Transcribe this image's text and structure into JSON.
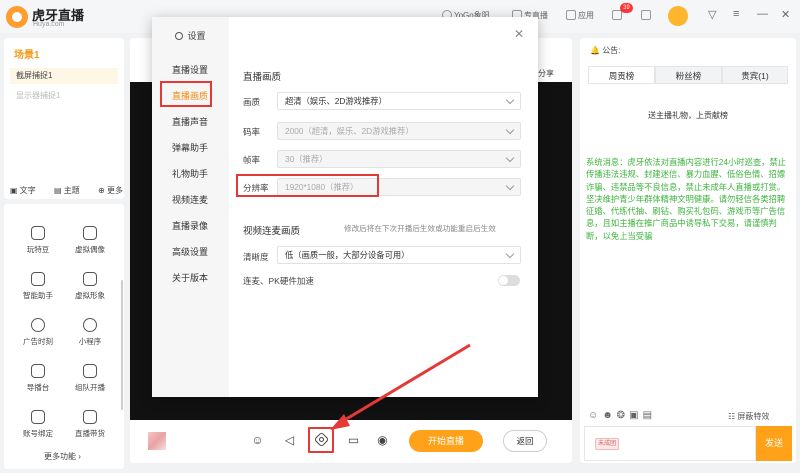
{
  "app": {
    "logo_text": "虎牙直播",
    "logo_sub": "Huya.com",
    "topbar": {
      "voice": "YoGo象阳",
      "live_gift": "专直播",
      "apps": "应用",
      "notif_count": "39"
    }
  },
  "sidebar": {
    "scene_title": "场景1",
    "sources": [
      "截屏捕捉1",
      "显示器捕捉1"
    ],
    "tools": [
      "文字",
      "主题",
      "更多"
    ],
    "functions": [
      "玩特豆",
      "虚拟偶像",
      "智能助手",
      "虚拟形象",
      "广告时刻",
      "小程序",
      "导播台",
      "组队开播",
      "账号绑定",
      "直播带货"
    ],
    "more_functions": "更多功能"
  },
  "center": {
    "share_label": "分享",
    "start_live": "开始直播",
    "back": "返回"
  },
  "right": {
    "notice_label": "公告:",
    "tabs": [
      "周贡榜",
      "粉丝榜",
      "贵宾(1)"
    ],
    "rank_empty": "送主播礼物，上贡献榜",
    "system_message": "系统消息：虎牙依法对直播内容进行24小时巡查，禁止传播违法违规、封建迷信、暴力血腥、低俗色情、招嫖诈骗、违禁品等不良信息，禁止未成年人直播或打赏。坚决维护青少年群体精神文明健康。请勿轻信各类招聘征婚、代练代抽、刷钻、购买礼包码、游戏币等广告信息，且如主播在推广商品中诱导私下交易，请谨慎判断，以免上当受骗",
    "shield_effects": "屏蔽特效",
    "level_badge": "未成团",
    "send": "发送"
  },
  "settings": {
    "title": "设置",
    "nav": [
      "直播设置",
      "直播画质",
      "直播声音",
      "弹幕助手",
      "礼物助手",
      "视频连麦",
      "直播录像",
      "高级设置",
      "关于版本"
    ],
    "active_nav": "直播画质",
    "section_quality": "直播画质",
    "rows": [
      {
        "label": "画质",
        "value": "超清（娱乐、2D游戏推荐）",
        "disabled": false
      },
      {
        "label": "码率",
        "value": "2000（超清，娱乐、2D游戏推荐）",
        "disabled": true
      },
      {
        "label": "帧率",
        "value": "30（推荐）",
        "disabled": true
      },
      {
        "label": "分辨率",
        "value": "1920*1080（推荐）",
        "disabled": true
      }
    ],
    "section_link": "视频连麦画质",
    "link_hint": "修改后将在下次开播后生效或功能重启后生效",
    "link_rows": [
      {
        "label": "清晰度",
        "value": "低（画质一般，大部分设备可用）"
      }
    ],
    "hw_accel_label": "连麦、PK硬件加速",
    "colors": {
      "accent": "#ffa21a",
      "highlight": "#e53935",
      "system_text": "#3cb43c"
    }
  }
}
